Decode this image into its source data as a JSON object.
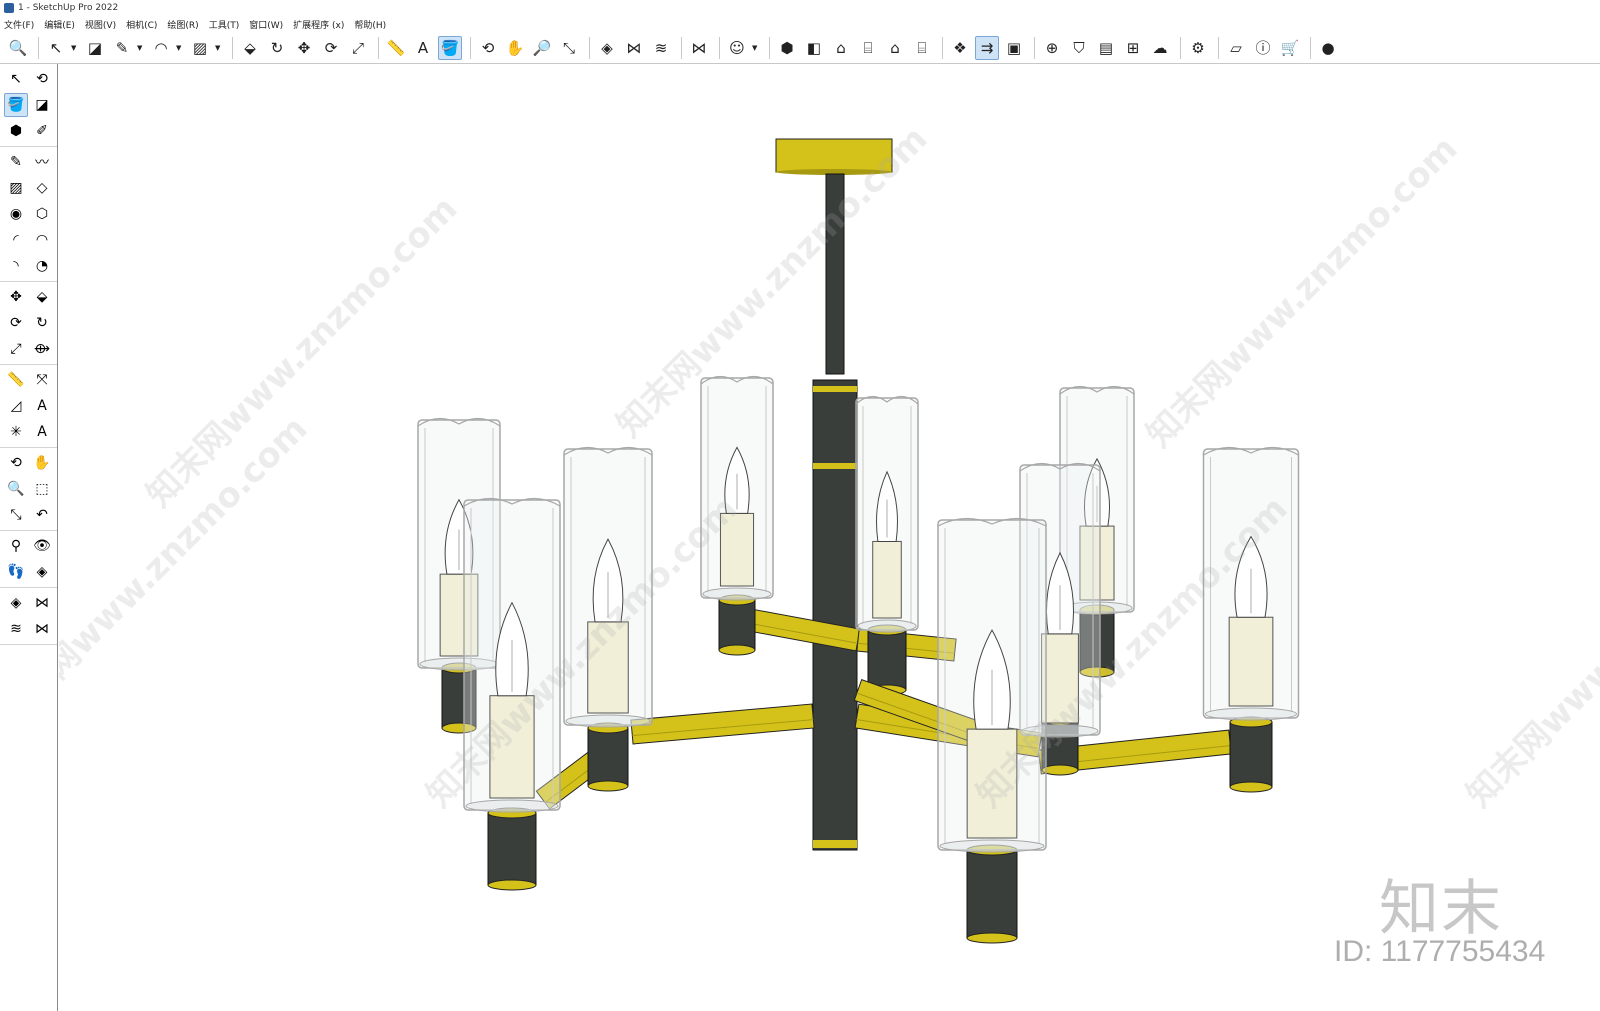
{
  "window": {
    "title": "1 - SketchUp Pro 2022"
  },
  "menus": [
    "文件(F)",
    "编辑(E)",
    "视图(V)",
    "相机(C)",
    "绘图(R)",
    "工具(T)",
    "窗口(W)",
    "扩展程序 (x)",
    "帮助(H)"
  ],
  "toolbar": [
    {
      "name": "zoom-window-icon",
      "glyph": "🔍"
    },
    {
      "sep": true
    },
    {
      "name": "select-icon",
      "glyph": "↖",
      "drop": true
    },
    {
      "name": "eraser-icon",
      "glyph": "◪"
    },
    {
      "name": "pencil-icon",
      "glyph": "✎",
      "drop": true
    },
    {
      "name": "arc-icon",
      "glyph": "◠",
      "drop": true
    },
    {
      "name": "rectangle-icon",
      "glyph": "▨",
      "drop": true
    },
    {
      "sep": true
    },
    {
      "name": "push-pull-icon",
      "glyph": "⬙"
    },
    {
      "name": "follow-me-icon",
      "glyph": "↻"
    },
    {
      "name": "move-icon",
      "glyph": "✥"
    },
    {
      "name": "rotate-icon",
      "glyph": "⟳"
    },
    {
      "name": "scale-icon",
      "glyph": "⤢"
    },
    {
      "sep": true
    },
    {
      "name": "tape-measure-icon",
      "glyph": "📏"
    },
    {
      "name": "text-icon",
      "glyph": "A"
    },
    {
      "name": "paint-bucket-icon",
      "glyph": "🪣",
      "active": true
    },
    {
      "sep": true
    },
    {
      "name": "orbit-icon",
      "glyph": "⟲"
    },
    {
      "name": "pan-icon",
      "glyph": "✋"
    },
    {
      "name": "zoom-icon",
      "glyph": "🔎"
    },
    {
      "name": "zoom-extents-icon",
      "glyph": "⤡"
    },
    {
      "sep": true
    },
    {
      "name": "section-plane-icon",
      "glyph": "◈"
    },
    {
      "name": "display-section-icon",
      "glyph": "⋈"
    },
    {
      "name": "layers-icon",
      "glyph": "≋"
    },
    {
      "sep": true
    },
    {
      "name": "section-fill-icon",
      "glyph": "⋈"
    },
    {
      "sep": true
    },
    {
      "name": "user-account-icon",
      "glyph": "☺",
      "drop": true
    },
    {
      "sep": true
    },
    {
      "name": "iso-view-icon",
      "glyph": "⬢"
    },
    {
      "name": "top-view-icon",
      "glyph": "◧"
    },
    {
      "name": "front-view-icon",
      "glyph": "⌂"
    },
    {
      "name": "right-view-icon",
      "glyph": "⌸"
    },
    {
      "name": "back-view-icon",
      "glyph": "⌂"
    },
    {
      "name": "left-view-icon",
      "glyph": "⌸"
    },
    {
      "sep": true
    },
    {
      "name": "components-icon",
      "glyph": "❖"
    },
    {
      "name": "outliner-icon",
      "glyph": "⇉",
      "active": true
    },
    {
      "name": "scenes-icon",
      "glyph": "▣"
    },
    {
      "sep": true
    },
    {
      "name": "add-location-icon",
      "glyph": "⊕"
    },
    {
      "name": "shield-icon",
      "glyph": "⛉"
    },
    {
      "name": "material-icon",
      "glyph": "▤"
    },
    {
      "name": "texture-icon",
      "glyph": "⊞"
    },
    {
      "name": "cloud-upload-icon",
      "glyph": "☁"
    },
    {
      "sep": true
    },
    {
      "name": "extension-manager-icon",
      "glyph": "⚙"
    },
    {
      "sep": true
    },
    {
      "name": "warehouse-icon",
      "glyph": "▱"
    },
    {
      "name": "info-icon",
      "glyph": "ⓘ"
    },
    {
      "name": "shopping-cart-icon",
      "glyph": "🛒"
    },
    {
      "sep": true
    },
    {
      "name": "profile-icon",
      "glyph": "●"
    }
  ],
  "left_tools": [
    [
      {
        "n": "select-tool-icon",
        "g": "↖"
      },
      {
        "n": "orbit-tool-icon",
        "g": "⟲"
      },
      {
        "n": "paint-tool-icon",
        "g": "🪣",
        "active": true
      },
      {
        "n": "eraser-tool-icon",
        "g": "◪"
      },
      {
        "n": "component-tool-icon",
        "g": "⬢"
      },
      {
        "n": "sample-tool-icon",
        "g": "✐"
      }
    ],
    [
      {
        "n": "line-tool-icon",
        "g": "✎"
      },
      {
        "n": "freehand-tool-icon",
        "g": "〰"
      },
      {
        "n": "rect-tool-icon",
        "g": "▨"
      },
      {
        "n": "rotated-rect-tool-icon",
        "g": "◇"
      },
      {
        "n": "circle-tool-icon",
        "g": "◉"
      },
      {
        "n": "polygon-tool-icon",
        "g": "⬡"
      },
      {
        "n": "arc-tool-icon",
        "g": "◜"
      },
      {
        "n": "two-point-arc-tool-icon",
        "g": "◠"
      },
      {
        "n": "three-point-arc-tool-icon",
        "g": "◝"
      },
      {
        "n": "pie-tool-icon",
        "g": "◔"
      }
    ],
    [
      {
        "n": "move-tool-icon",
        "g": "✥"
      },
      {
        "n": "push-pull-tool-icon",
        "g": "⬙"
      },
      {
        "n": "rotate-tool-icon",
        "g": "⟳"
      },
      {
        "n": "follow-me-tool-icon",
        "g": "↻"
      },
      {
        "n": "scale-tool-icon",
        "g": "⤢"
      },
      {
        "n": "offset-tool-icon",
        "g": "⟴"
      }
    ],
    [
      {
        "n": "tape-tool-icon",
        "g": "📏"
      },
      {
        "n": "dimension-tool-icon",
        "g": "⤧"
      },
      {
        "n": "protractor-tool-icon",
        "g": "◿"
      },
      {
        "n": "text-tool-icon",
        "g": "A"
      },
      {
        "n": "axes-tool-icon",
        "g": "✳"
      },
      {
        "n": "3d-text-tool-icon",
        "g": "A"
      }
    ],
    [
      {
        "n": "orbit-nav-icon",
        "g": "⟲"
      },
      {
        "n": "pan-nav-icon",
        "g": "✋"
      },
      {
        "n": "zoom-nav-icon",
        "g": "🔍"
      },
      {
        "n": "zoom-window-nav-icon",
        "g": "⬚"
      },
      {
        "n": "zoom-extents-nav-icon",
        "g": "⤡"
      },
      {
        "n": "previous-view-icon",
        "g": "↶"
      }
    ],
    [
      {
        "n": "position-camera-icon",
        "g": "⚲"
      },
      {
        "n": "look-around-icon",
        "g": "👁"
      },
      {
        "n": "walk-icon",
        "g": "👣"
      },
      {
        "n": "section-plane-tool-icon",
        "g": "◈"
      }
    ],
    [
      {
        "n": "section-tool-icon",
        "g": "◈"
      },
      {
        "n": "section-display-icon",
        "g": "⋈"
      },
      {
        "n": "layer-tool-icon",
        "g": "≋"
      },
      {
        "n": "section-fill-tool-icon",
        "g": "⋈"
      }
    ]
  ],
  "watermark": {
    "text": "知末网www.znzmo.com",
    "logo": "知末",
    "id_label": "ID: 1177755434"
  },
  "colors": {
    "brass": "#d4c21a",
    "brass_dark": "#a89a10",
    "black_metal": "#3a3e3b",
    "bulb": "#ffffff",
    "candle": "#f1efd8",
    "glass_edge": "#a7a7a7"
  }
}
